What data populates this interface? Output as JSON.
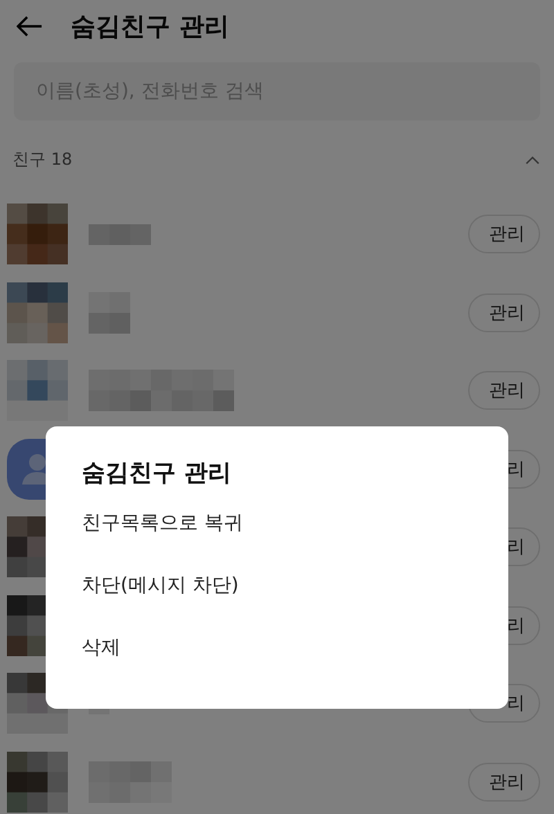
{
  "header": {
    "title": "숨김친구 관리"
  },
  "search": {
    "placeholder": "이름(초성), 전화번호 검색"
  },
  "section": {
    "label": "친구 18",
    "expanded": true
  },
  "friends": [
    {
      "button": "관리"
    },
    {
      "button": "관리"
    },
    {
      "button": "관리"
    },
    {
      "kind": "default",
      "button": "리"
    },
    {
      "button": "리"
    },
    {
      "button": "리"
    },
    {
      "button": "리"
    },
    {
      "button": "관리"
    }
  ],
  "dialog": {
    "title": "숨김친구 관리",
    "options": [
      "친구목록으로 복귀",
      "차단(메시지 차단)",
      "삭제"
    ]
  }
}
